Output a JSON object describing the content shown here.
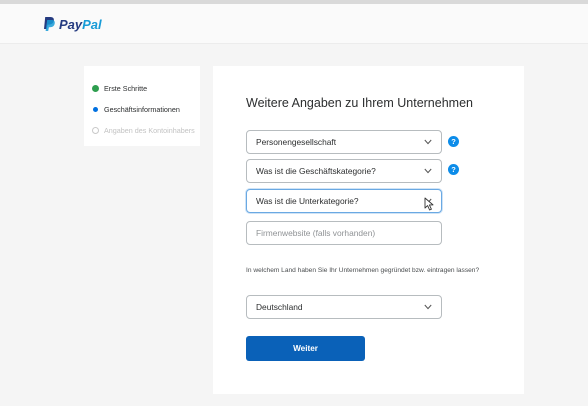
{
  "brand": {
    "name_pay": "Pay",
    "name_pal": "Pal",
    "logo_icon": "paypal-p-icon",
    "color_dark": "#253b80",
    "color_light": "#179bd7"
  },
  "steps": [
    {
      "label": "Erste Schritte",
      "status": "done",
      "icon": "check-dot-icon"
    },
    {
      "label": "Geschäftsinformationen",
      "status": "active",
      "icon": "current-dot-icon"
    },
    {
      "label": "Angaben des Kontoinhabers",
      "status": "todo",
      "icon": "empty-dot-icon"
    }
  ],
  "form": {
    "title": "Weitere Angaben zu Ihrem Unternehmen",
    "business_type": {
      "value": "Personengesellschaft"
    },
    "category": {
      "value": "Was ist die Geschäftskategorie?"
    },
    "subcategory": {
      "value": "Was ist die Unterkategorie?"
    },
    "website": {
      "placeholder": "Firmenwebsite (falls vorhanden)"
    },
    "country_question": "In welchem Land haben Sie Ihr Unternehmen gegründet bzw. eintragen lassen?",
    "country": {
      "value": "Deutschland"
    },
    "submit_label": "Weiter",
    "help_glyph": "?"
  },
  "colors": {
    "accent": "#0a61b8",
    "help": "#0c8ce9",
    "done": "#2e9e4f",
    "active": "#0070e0"
  }
}
